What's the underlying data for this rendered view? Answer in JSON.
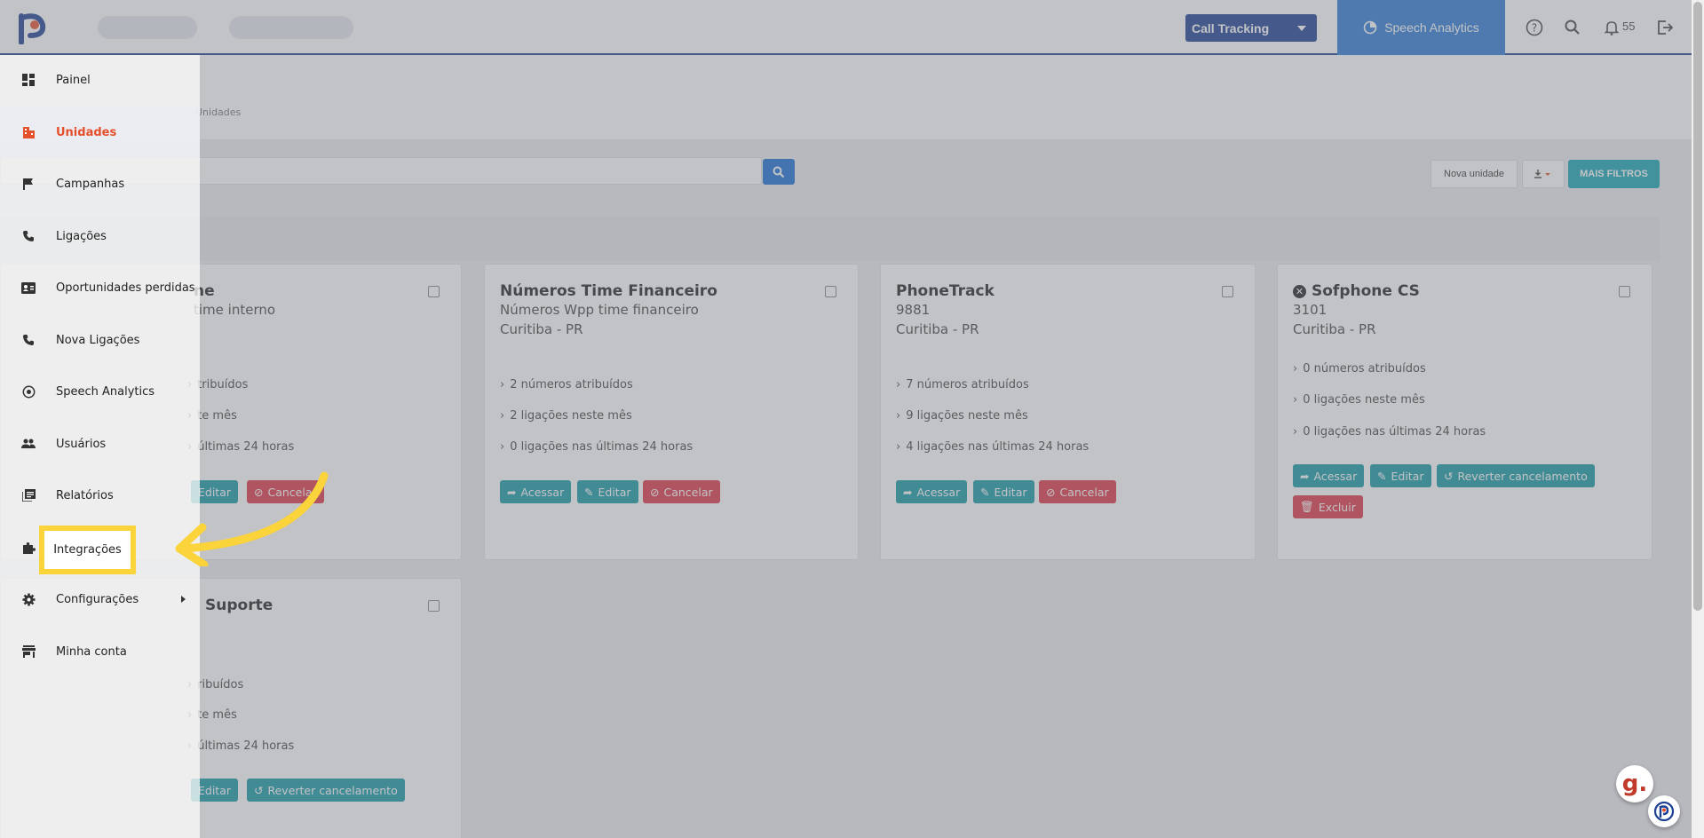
{
  "topbar": {
    "call_tracking_label": "Call Tracking",
    "speech_analytics_label": "Speech Analytics",
    "notifications_count": "55"
  },
  "breadcrumb": "Unidades",
  "toolbar": {
    "new_unit_label": "Nova unidade",
    "more_filters_label": "MAIS FILTROS"
  },
  "cards": [
    {
      "title": "ne",
      "subtitle": "time interno",
      "stats": [
        "tribuídos",
        "te mês",
        "últimas 24 horas"
      ],
      "buttons": [
        "Editar",
        "Cancelar"
      ]
    },
    {
      "title": "Números Time Financeiro",
      "subtitle": "Números Wpp time financeiro",
      "location": "Curitiba - PR",
      "stats": [
        "2 números atribuídos",
        "2 ligações neste mês",
        "0 ligações nas últimas 24 horas"
      ],
      "buttons": [
        "Acessar",
        "Editar",
        "Cancelar"
      ]
    },
    {
      "title": "PhoneTrack",
      "subtitle": "9881",
      "location": "Curitiba - PR",
      "stats": [
        "7 números atribuídos",
        "9 ligações neste mês",
        "4 ligações nas últimas 24 horas"
      ],
      "buttons": [
        "Acessar",
        "Editar",
        "Cancelar"
      ]
    },
    {
      "title": "Sofphone CS",
      "subtitle": "3101",
      "location": "Curitiba - PR",
      "stats": [
        "0 números atribuídos",
        "0 ligações neste mês",
        "0 ligações nas últimas 24 horas"
      ],
      "buttons": [
        "Acessar",
        "Editar",
        "Reverter cancelamento",
        "Excluir"
      ]
    },
    {
      "title": "Suporte",
      "stats": [
        "ribuídos",
        "te mês",
        "últimas 24 horas"
      ],
      "buttons": [
        "Editar",
        "Reverter cancelamento"
      ]
    }
  ],
  "sidebar": {
    "items": [
      {
        "label": "Painel",
        "icon": "dashboard-icon"
      },
      {
        "label": "Unidades",
        "icon": "building-icon"
      },
      {
        "label": "Campanhas",
        "icon": "flag-icon"
      },
      {
        "label": "Ligações",
        "icon": "phone-icon"
      },
      {
        "label": "Oportunidades perdidas",
        "icon": "contact-card-icon"
      },
      {
        "label": "Nova Ligações",
        "icon": "phone-icon"
      },
      {
        "label": "Speech Analytics",
        "icon": "speech-analytics-icon"
      },
      {
        "label": "Usuários",
        "icon": "users-icon"
      },
      {
        "label": "Relatórios",
        "icon": "reports-icon"
      },
      {
        "label": "Integrações",
        "icon": "puzzle-icon"
      },
      {
        "label": "Configurações",
        "icon": "gear-icon"
      },
      {
        "label": "Minha conta",
        "icon": "store-icon"
      }
    ],
    "active_item": "Unidades",
    "highlighted_item": "Integrações"
  },
  "colors": {
    "accent_blue": "#1d3f94",
    "speech_blue": "#2c7bd6",
    "teal": "#149aa6",
    "danger": "#dc3545",
    "active_orange": "#e4502b",
    "highlight_yellow": "#fbd33b"
  }
}
